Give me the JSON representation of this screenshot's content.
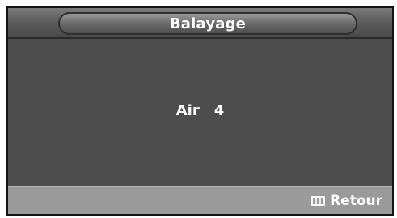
{
  "osd": {
    "title": "Balayage",
    "source_label": "Air",
    "channel_number": "4",
    "footer": {
      "return_label": "Retour",
      "return_icon": "menu-icon"
    }
  }
}
